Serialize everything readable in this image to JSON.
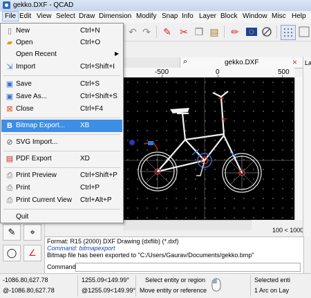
{
  "window": {
    "title": "gekko.DXF - QCAD"
  },
  "menubar": {
    "items": [
      "File",
      "Edit",
      "View",
      "Select",
      "Draw",
      "Dimension",
      "Modify",
      "Snap",
      "Info",
      "Layer",
      "Block",
      "Window",
      "Misc",
      "Help"
    ]
  },
  "file_menu": {
    "items": [
      {
        "label": "New",
        "shortcut": "Ctrl+N",
        "icon": "new-file-icon"
      },
      {
        "label": "Open",
        "shortcut": "Ctrl+O",
        "icon": "open-folder-icon"
      },
      {
        "label": "Open Recent",
        "shortcut": "",
        "icon": ""
      },
      {
        "label": "Import",
        "shortcut": "Ctrl+Shift+I",
        "icon": "import-icon"
      },
      {
        "label": "Save",
        "shortcut": "Ctrl+S",
        "icon": "save-icon"
      },
      {
        "label": "Save As...",
        "shortcut": "Ctrl+Shift+S",
        "icon": "save-as-icon"
      },
      {
        "label": "Close",
        "shortcut": "Ctrl+F4",
        "icon": "close-file-icon"
      },
      {
        "label": "Bitmap Export...",
        "shortcut": "XB",
        "icon": "bitmap-icon"
      },
      {
        "label": "SVG Import...",
        "shortcut": "",
        "icon": "svg-icon"
      },
      {
        "label": "PDF Export",
        "shortcut": "XD",
        "icon": "pdf-icon"
      },
      {
        "label": "Print Preview",
        "shortcut": "Ctrl+Shift+P",
        "icon": "print-preview-icon"
      },
      {
        "label": "Print",
        "shortcut": "Ctrl+P",
        "icon": "print-icon"
      },
      {
        "label": "Print Current View",
        "shortcut": "Ctrl+Alt+P",
        "icon": "print-view-icon"
      },
      {
        "label": "Quit",
        "shortcut": "",
        "icon": ""
      }
    ],
    "highlighted": "Bitmap Export..."
  },
  "tab": {
    "title": "gekko.DXF"
  },
  "ruler": {
    "h_labels": [
      "-500",
      "0",
      "500"
    ]
  },
  "zoom": {
    "label": "100 < 1000"
  },
  "command": {
    "lines": [
      "Format: R15 (2000) DXF Drawing (dxflib) (*.dxf)",
      "Command: bitmapexport",
      "Bitmap file has been exported to \"C:/Users/Gaurav/Documents/gekko.bmp\""
    ],
    "prompt_label": "Command:",
    "input_value": ""
  },
  "status": {
    "abs_coord": "-1086.80,627.78",
    "rel_coord": "@-1086.80,627.78",
    "polar_coord": "1255.09<149.99°",
    "rel_polar_coord": "@1255.09<149.99°",
    "mouse_left": "Select entity or region",
    "mouse_right": "Move entity or reference",
    "selected_label": "Selected enti",
    "selected_value": "1 Arc on Lay"
  },
  "dock": {
    "tab_label": "La"
  },
  "colors": {
    "menu_highlight": "#3d8ee6",
    "canvas_bg": "#000000",
    "command_blue": "#1c44b5"
  }
}
